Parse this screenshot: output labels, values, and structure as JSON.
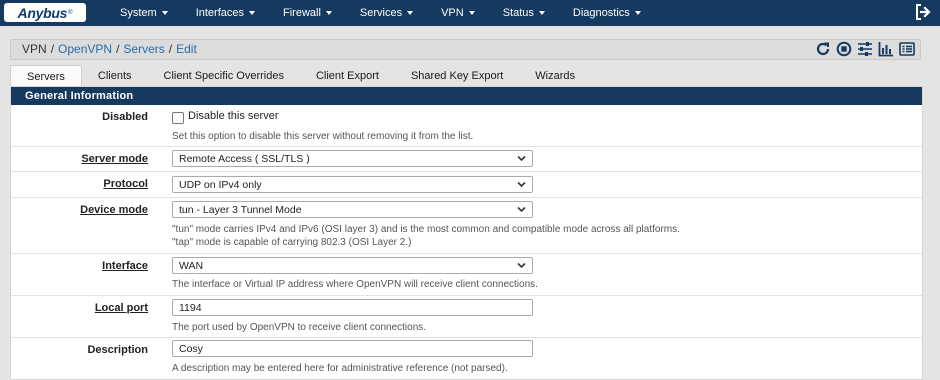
{
  "brand": {
    "logo_text": "Anybus",
    "logo_mark": "®"
  },
  "nav": {
    "items": [
      {
        "label": "System"
      },
      {
        "label": "Interfaces"
      },
      {
        "label": "Firewall"
      },
      {
        "label": "Services"
      },
      {
        "label": "VPN"
      },
      {
        "label": "Status"
      },
      {
        "label": "Diagnostics"
      }
    ],
    "logout_icon": "logout-icon"
  },
  "breadcrumb": {
    "items": [
      "VPN",
      "OpenVPN",
      "Servers",
      "Edit"
    ],
    "separator": "/",
    "icons": [
      "reload-icon",
      "stop-icon",
      "sliders-icon",
      "chart-icon",
      "list-icon"
    ]
  },
  "tabs": [
    {
      "label": "Servers",
      "active": true
    },
    {
      "label": "Clients"
    },
    {
      "label": "Client Specific Overrides"
    },
    {
      "label": "Client Export"
    },
    {
      "label": "Shared Key Export"
    },
    {
      "label": "Wizards"
    }
  ],
  "section": {
    "title": "General Information",
    "disabled": {
      "label": "Disabled",
      "checkbox_label": "Disable this server",
      "checked": false,
      "help": "Set this option to disable this server without removing it from the list."
    },
    "server_mode": {
      "label": "Server mode",
      "value": "Remote Access ( SSL/TLS )"
    },
    "protocol": {
      "label": "Protocol",
      "value": "UDP on IPv4 only"
    },
    "device_mode": {
      "label": "Device mode",
      "value": "tun - Layer 3 Tunnel Mode",
      "help1": "\"tun\" mode carries IPv4 and IPv6 (OSI layer 3) and is the most common and compatible mode across all platforms.",
      "help2": "\"tap\" mode is capable of carrying 802.3 (OSI Layer 2.)"
    },
    "interface": {
      "label": "Interface",
      "value": "WAN",
      "help": "The interface or Virtual IP address where OpenVPN will receive client connections."
    },
    "local_port": {
      "label": "Local port",
      "value": "1194",
      "help": "The port used by OpenVPN to receive client connections."
    },
    "description": {
      "label": "Description",
      "value": "Cosy",
      "help": "A description may be entered here for administrative reference (not parsed)."
    }
  },
  "colors": {
    "navbar": "#15395f",
    "link": "#2b6aa8",
    "panel_header": "#15395f",
    "background": "#e4e4e4"
  }
}
